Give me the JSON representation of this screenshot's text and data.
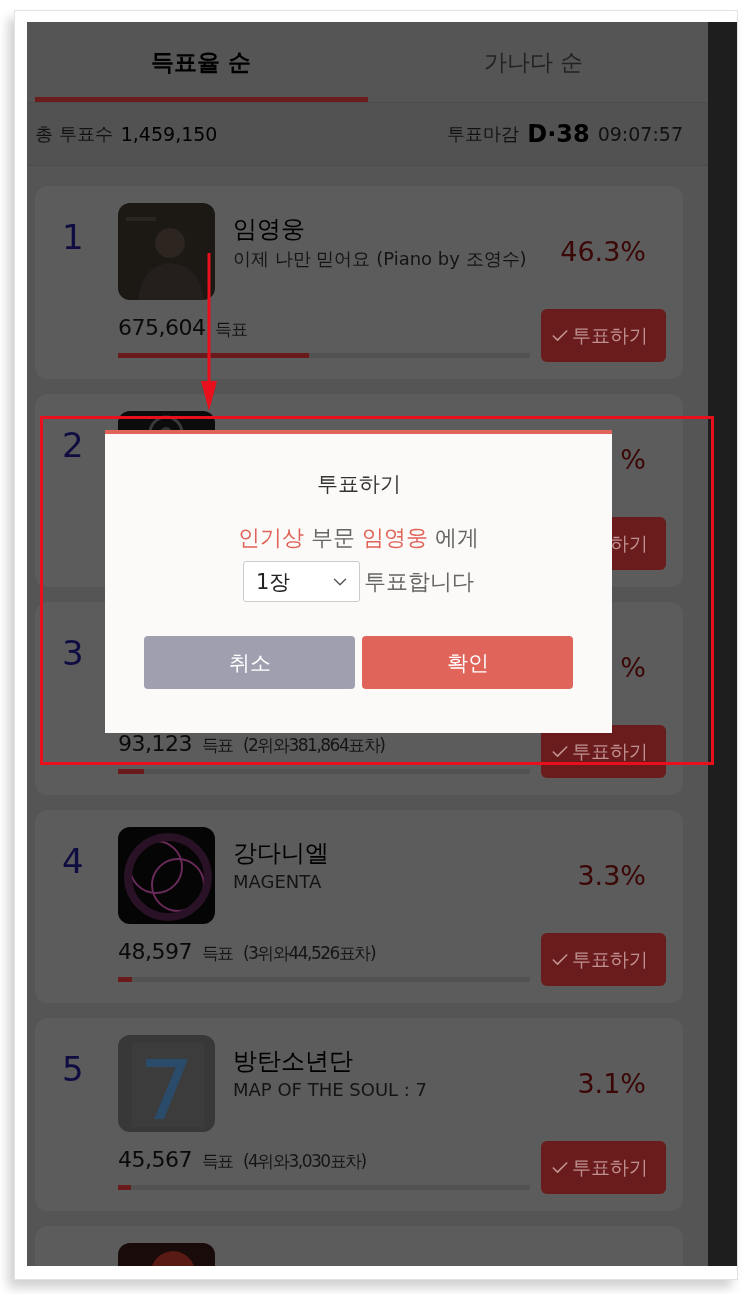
{
  "tabs": [
    {
      "label": "득표율 순",
      "selected": true
    },
    {
      "label": "가나다 순",
      "selected": false
    }
  ],
  "summary": {
    "total_label": "총 투표수",
    "total": "1,459,150",
    "deadline_label": "투표마감",
    "dday": "D·38",
    "time": "09:07:57"
  },
  "candidates": [
    {
      "rank": "1",
      "art": {
        "kind": "picture"
      },
      "name": "임영웅",
      "song": "이제 나만 믿어요 (Piano by 조영수)",
      "percent": "46.3%",
      "votes": "675,604",
      "unit": "득표",
      "level": 0.463,
      "button": {
        "label": "투표하기",
        "check": true
      }
    },
    {
      "rank": "2",
      "art": {
        "kind": "picture"
      },
      "percent": "%",
      "button": {
        "label": "하기",
        "check": false
      }
    },
    {
      "rank": "3",
      "percent": "%",
      "votes": "93,123",
      "unit": "득표",
      "gap": "(2위와381,864표차)",
      "level": 0.064,
      "button": {
        "label": "투표하기",
        "check": true
      }
    },
    {
      "rank": "4",
      "art": {
        "kind": "picture"
      },
      "name": "강다니엘",
      "song": "MAGENTA",
      "percent": "3.3%",
      "votes": "48,597",
      "unit": "득표",
      "gap": "(3위와44,526표차)",
      "level": 0.033,
      "button": {
        "label": "투표하기",
        "check": true
      }
    },
    {
      "rank": "5",
      "art": {
        "kind": "picture"
      },
      "name": "방탄소년단",
      "song": "MAP OF THE SOUL : 7",
      "percent": "3.1%",
      "votes": "45,567",
      "unit": "득표",
      "gap": "(4위와3,030표차)",
      "level": 0.031,
      "button": {
        "label": "투표하기",
        "check": true
      }
    },
    {
      "art": {
        "kind": "picture"
      }
    }
  ],
  "modal": {
    "title": "투표하기",
    "message": "**인기상** 부문 **임영웅** 에게",
    "select": {
      "value": "1장"
    },
    "suffix": "투표합니다",
    "buttons": [
      {
        "label": "취소",
        "kind": "cancel"
      },
      {
        "label": "확인",
        "kind": "confirm"
      }
    ]
  }
}
